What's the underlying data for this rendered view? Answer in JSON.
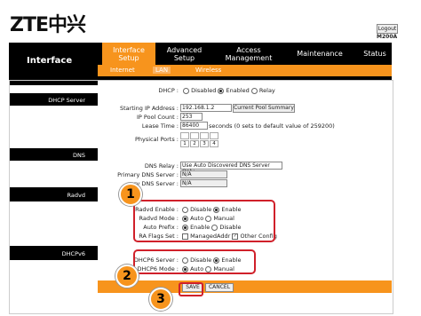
{
  "brand": "ZTE中兴",
  "header": {
    "logout": "Logout",
    "model": "M200A"
  },
  "nav": {
    "title": "Interface",
    "tabs": [
      {
        "label": "Interface\nSetup"
      },
      {
        "label": "Advanced\nSetup"
      },
      {
        "label": "Access\nManagement"
      },
      {
        "label": "Maintenance"
      },
      {
        "label": "Status"
      }
    ],
    "subtabs": [
      "Internet",
      "LAN",
      "Wireless"
    ]
  },
  "sections": {
    "dhcp_server": "DHCP Server",
    "dns": "DNS",
    "radvd": "Radvd",
    "dhcpv6": "DHCPv6"
  },
  "dhcp": {
    "label": "DHCP :",
    "options": [
      "Disabled",
      "Enabled",
      "Relay"
    ]
  },
  "dhcp_server": {
    "start_ip_label": "Starting IP Address :",
    "start_ip": "192.168.1.2",
    "pool_button": "Current Pool Summary",
    "pool_count_label": "IP Pool Count :",
    "pool_count": "253",
    "lease_label": "Lease Time :",
    "lease": "86400",
    "lease_note": "seconds   (0 sets to default value of 259200)",
    "ports_label": "Physical Ports :",
    "ports": [
      "1",
      "2",
      "3",
      "4"
    ]
  },
  "dns": {
    "relay_label": "DNS Relay :",
    "relay_value": "Use Auto Discovered DNS Server Only",
    "primary_label": "Primary DNS Server :",
    "primary_value": "N/A",
    "secondary_label": "ry DNS Server :",
    "secondary_value": "N/A"
  },
  "radvd": {
    "enable_label": "Radvd Enable :",
    "enable_opts": [
      "Disable",
      "Enable"
    ],
    "mode_label": "Radvd Mode :",
    "mode_opts": [
      "Auto",
      "Manual"
    ],
    "prefix_label": "Auto Prefix :",
    "prefix_opts": [
      "Enable",
      "Disable"
    ],
    "flags_label": "RA Flags Set :",
    "flags_opts": [
      "ManagedAddr",
      "Other Config"
    ]
  },
  "dhcpv6": {
    "server_label": "DHCP6 Server :",
    "server_opts": [
      "Disable",
      "Enable"
    ],
    "mode_label": "DHCP6 Mode :",
    "mode_opts": [
      "Auto",
      "Manual"
    ]
  },
  "footer": {
    "save": "SAVE",
    "cancel": "CANCEL"
  },
  "callouts": [
    "1",
    "2",
    "3"
  ],
  "colors": {
    "accent": "#f7941d",
    "highlight": "#d0202a",
    "nav_bg": "#000000"
  }
}
